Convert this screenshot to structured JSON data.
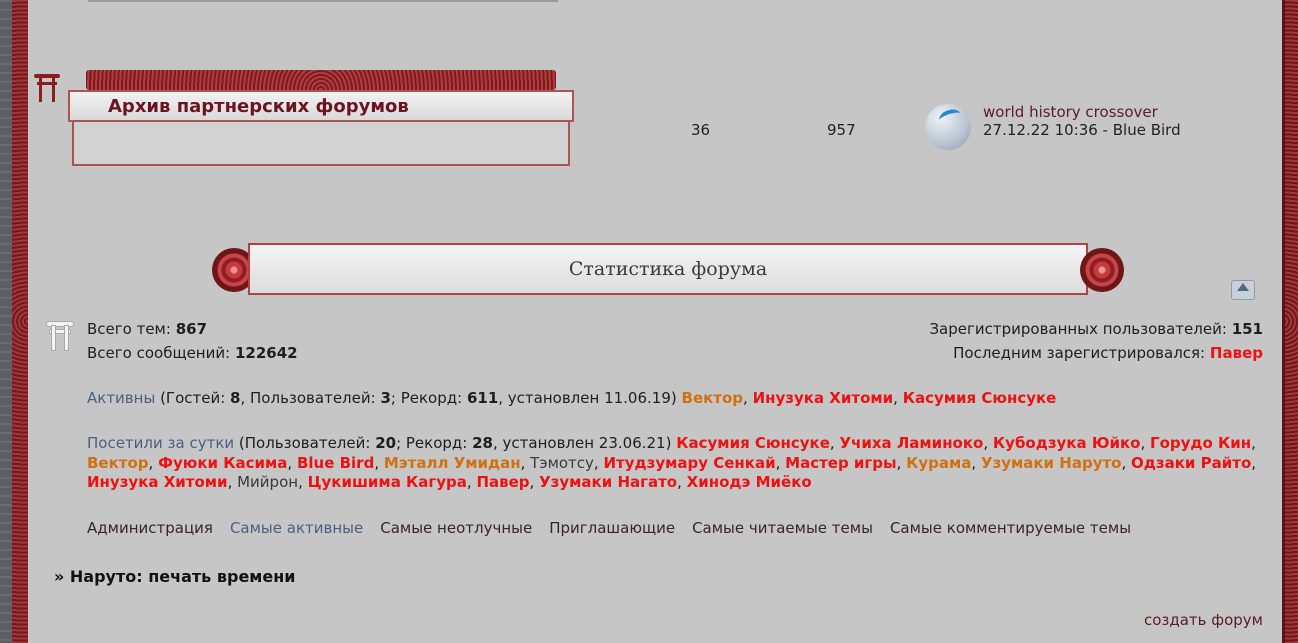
{
  "forum_row": {
    "title": "Архив партнерских форумов",
    "topics": "36",
    "posts": "957",
    "last_post_topic": "world history crossover",
    "last_post_meta": "27.12.22 10:36 - Blue Bird"
  },
  "stats": {
    "heading": "Статистика форума",
    "total_topics_label": "Всего тем:",
    "total_topics": "867",
    "total_posts_label": "Всего сообщений:",
    "total_posts": "122642",
    "registered_label": "Зарегистрированных пользователей:",
    "registered": "151",
    "last_registered_label": "Последним зарегистрировался:",
    "last_registered": "Павер"
  },
  "active": {
    "link": "Активны",
    "text_open": " (Гостей: ",
    "guests": "8",
    "text_users": ", Пользователей: ",
    "users": "3",
    "text_record": "; Рекорд: ",
    "record": "611",
    "text_set": ", установлен 11.06.19)",
    "members": [
      {
        "name": "Вектор",
        "style": "orange"
      },
      {
        "name": "Инузука Хитоми",
        "style": "red"
      },
      {
        "name": "Касумия Сюнсуке",
        "style": "red"
      }
    ]
  },
  "visited": {
    "link": "Посетили за сутки",
    "text_open": " (Пользователей: ",
    "users": "20",
    "text_record": "; Рекорд: ",
    "record": "28",
    "text_set": ", установлен 23.06.21)",
    "members": [
      {
        "name": "Касумия Сюнсуке",
        "style": "red"
      },
      {
        "name": "Учиха Ламиноко",
        "style": "red"
      },
      {
        "name": "Кубодзука Юйко",
        "style": "red"
      },
      {
        "name": "Горудо Кин",
        "style": "red"
      },
      {
        "name": "Вектор",
        "style": "orange"
      },
      {
        "name": "Фуюки Касима",
        "style": "red"
      },
      {
        "name": "Blue Bird",
        "style": "red"
      },
      {
        "name": "Мэталл Умидан",
        "style": "orange"
      },
      {
        "name": "Тэмотсу",
        "style": "plain"
      },
      {
        "name": "Итудзумару Сенкай",
        "style": "red"
      },
      {
        "name": "Мастер игры",
        "style": "red"
      },
      {
        "name": "Курама",
        "style": "orange"
      },
      {
        "name": "Узумаки Наруто",
        "style": "orange"
      },
      {
        "name": "Одзаки Райто",
        "style": "red"
      },
      {
        "name": "Инузука Хитоми",
        "style": "red"
      },
      {
        "name": "Мийрон",
        "style": "plain"
      },
      {
        "name": "Цукишима Кагура",
        "style": "red"
      },
      {
        "name": "Павер",
        "style": "red"
      },
      {
        "name": "Узумаки Нагато",
        "style": "red"
      },
      {
        "name": "Хинодэ Миёко",
        "style": "red"
      }
    ]
  },
  "nav": [
    {
      "label": "Администрация",
      "active": false
    },
    {
      "label": "Самые активные",
      "active": true
    },
    {
      "label": "Самые неотлучные",
      "active": false
    },
    {
      "label": "Приглашающие",
      "active": false
    },
    {
      "label": "Самые читаемые темы",
      "active": false
    },
    {
      "label": "Самые комментируемые темы",
      "active": false
    }
  ],
  "group_title": "» Наруто: печать времени",
  "create_forum": "создать форум",
  "colors": {
    "background": "#c6c6c6",
    "accent_red": "#ee1111",
    "accent_orange": "#d07010",
    "link_blue": "#4a5f80",
    "frame_red": "#8d1c1c"
  },
  "icons": {
    "forum": "torii-icon",
    "stats": "torii-icon",
    "back_to_top": "arrow-up-icon"
  }
}
